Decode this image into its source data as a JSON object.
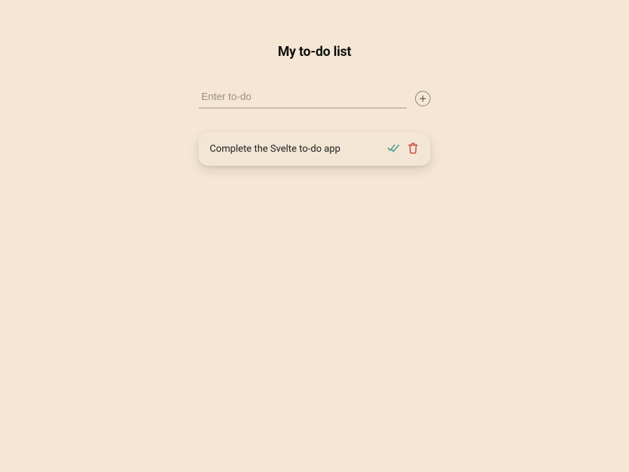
{
  "title": "My to-do list",
  "input": {
    "placeholder": "Enter to-do",
    "value": ""
  },
  "todos": [
    {
      "text": "Complete the Svelte to-do app",
      "done": false
    }
  ],
  "icons": {
    "add": "plus-icon",
    "complete": "check-icon",
    "delete": "trash-icon"
  },
  "colors": {
    "background": "#f5e7d3",
    "card": "#f3e6d4",
    "check": "#4a9b8e",
    "trash": "#c94b3a",
    "text": "#1a1a1a"
  }
}
